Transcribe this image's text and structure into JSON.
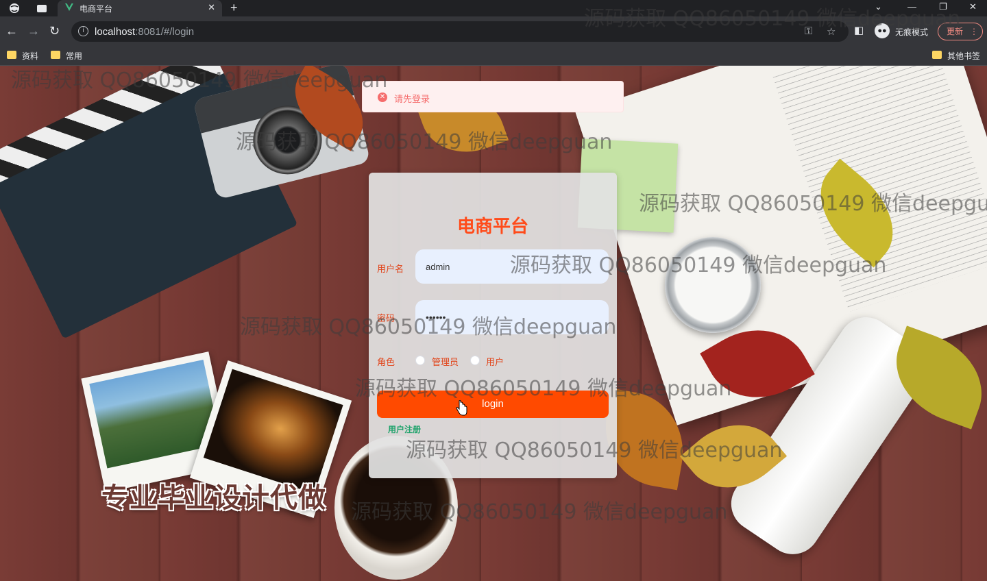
{
  "browser": {
    "tab_title": "电商平台",
    "tab_close": "✕",
    "new_tab": "+",
    "url_host": "localhost",
    "url_rest": ":8081/#/login",
    "incognito_label": "无痕模式",
    "update_label": "更新",
    "bookmarks": [
      "资料",
      "常用"
    ],
    "other_bookmarks": "其他书签"
  },
  "page": {
    "promo_text": "专业毕业设计代做"
  },
  "toast": {
    "message": "请先登录"
  },
  "login": {
    "title": "电商平台",
    "username_label": "用户名",
    "username_value": "admin",
    "password_label": "密码",
    "password_value": "••••••",
    "role_label": "角色",
    "roles": [
      "管理员",
      "用户"
    ],
    "login_button": "login",
    "register_link": "用户注册"
  },
  "watermark": {
    "text": "源码获取 QQ86050149 微信deepguan"
  }
}
